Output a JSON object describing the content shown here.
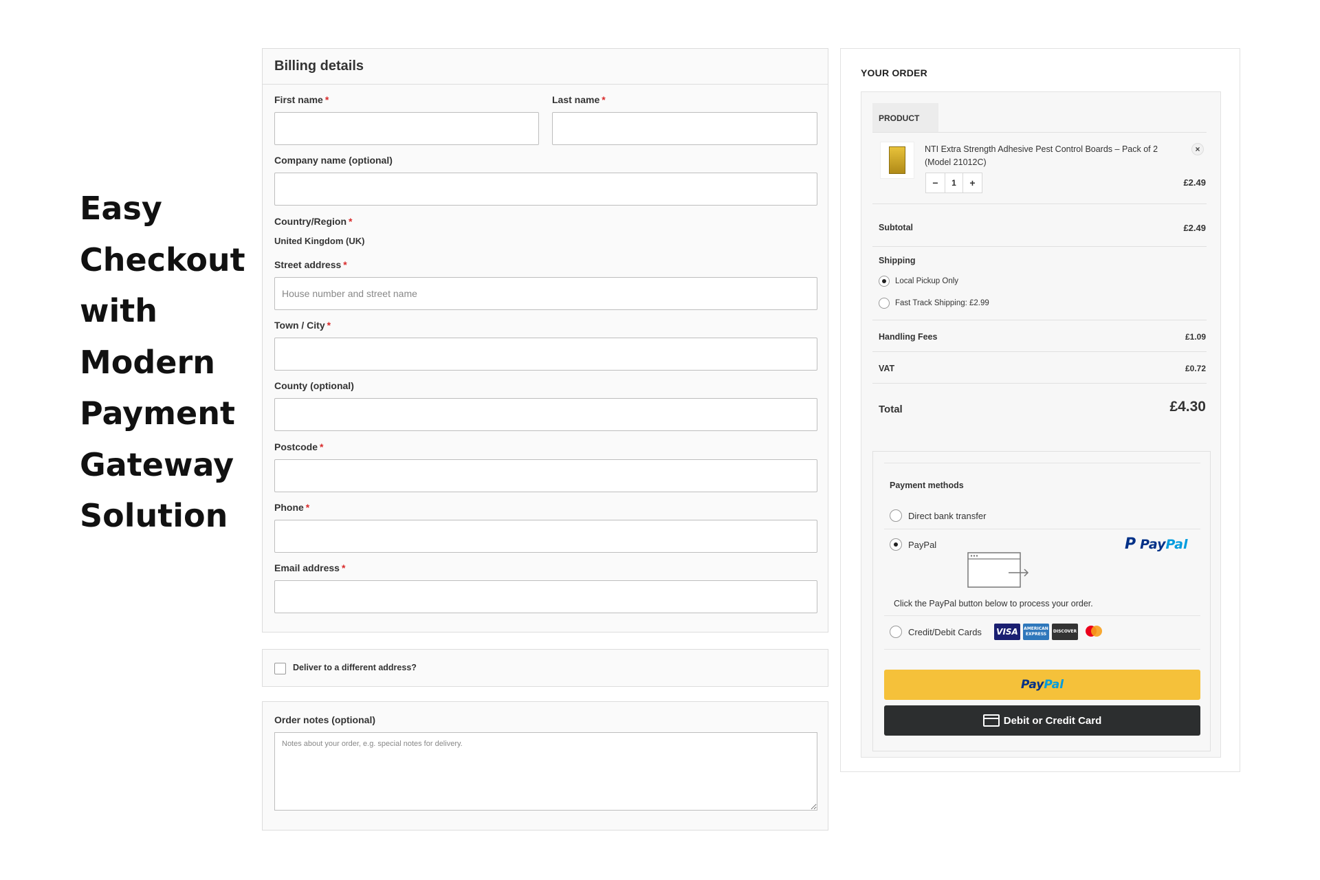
{
  "hero": {
    "lines": [
      "Easy",
      "Checkout",
      "with",
      "Modern",
      "Payment",
      "Gateway",
      "Solution"
    ]
  },
  "billing": {
    "title": "Billing details",
    "first_name_label": "First name",
    "last_name_label": "Last name",
    "company_label": "Company name (optional)",
    "country_label": "Country/Region",
    "country_value": "United Kingdom (UK)",
    "street_label": "Street address",
    "street_placeholder": "House number and street name",
    "town_label": "Town / City",
    "county_label": "County (optional)",
    "postcode_label": "Postcode",
    "phone_label": "Phone",
    "email_label": "Email address",
    "required_mark": "*"
  },
  "deliver": {
    "label": "Deliver to a different address?"
  },
  "notes": {
    "label": "Order notes (optional)",
    "placeholder": "Notes about your order, e.g. special notes for delivery."
  },
  "order": {
    "title": "YOUR ORDER",
    "product_header": "PRODUCT",
    "product_name": "NTI Extra Strength Adhesive Pest Control Boards – Pack of 2 (Model 21012C)",
    "remove": "×",
    "qty_minus": "−",
    "qty_value": "1",
    "qty_plus": "+",
    "product_price": "£2.49",
    "subtotal_label": "Subtotal",
    "subtotal_value": "£2.49",
    "shipping_label": "Shipping",
    "shipping_options": [
      "Local Pickup Only",
      "Fast Track Shipping: £2.99"
    ],
    "shipping_selected": 0,
    "handling_label": "Handling Fees",
    "handling_value": "£1.09",
    "vat_label": "VAT",
    "vat_value": "£0.72",
    "total_label": "Total",
    "total_value": "£4.30"
  },
  "payment": {
    "title": "Payment methods",
    "bank_label": "Direct bank transfer",
    "paypal_label": "PayPal",
    "paypal_logo_text_1": "Pay",
    "paypal_logo_text_2": "Pal",
    "paypal_note": "Click the PayPal button below to process your order.",
    "cards_label": "Credit/Debit Cards",
    "card_brands": [
      "VISA",
      "AMERICAN EXPRESS",
      "DISCOVER",
      "mastercard"
    ],
    "selected": "paypal",
    "paypal_button_1": "Pay",
    "paypal_button_2": "Pal",
    "card_button": "Debit or Credit Card"
  },
  "colors": {
    "paypal_yellow": "#f5c13a",
    "paypal_blue": "#003087",
    "paypal_light_blue": "#009cde",
    "card_button": "#2c2e2f",
    "required": "#d92b2b"
  }
}
